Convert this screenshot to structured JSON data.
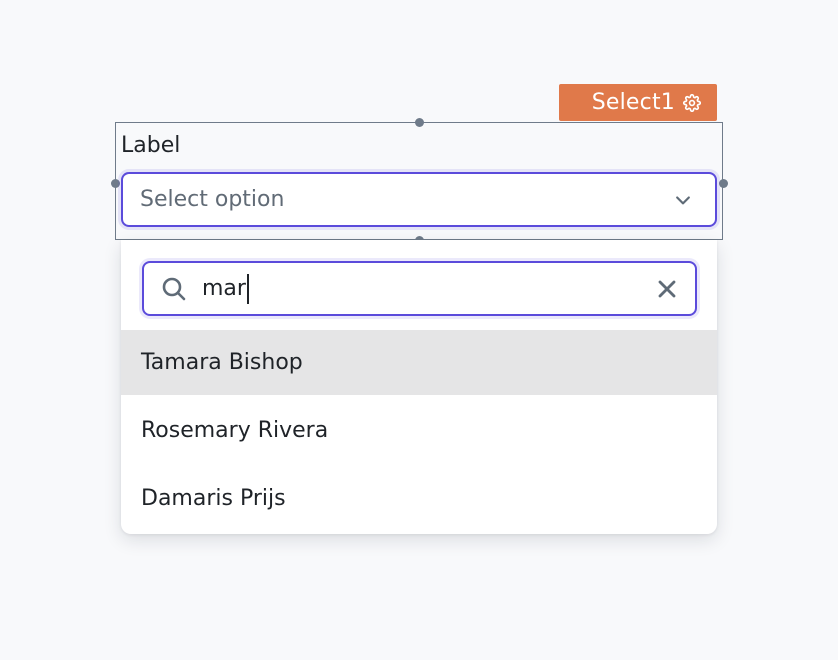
{
  "component_tag": {
    "name": "Select1",
    "icon": "gear-icon",
    "color": "#e0794a"
  },
  "field": {
    "label": "Label",
    "placeholder": "Select option",
    "chevron_icon": "chevron-down-icon",
    "accent_color": "#5b4bdb"
  },
  "search": {
    "value": "mar",
    "icon": "search-icon",
    "clear_icon": "close-icon"
  },
  "options": [
    {
      "label": "Tamara Bishop",
      "highlighted": true
    },
    {
      "label": "Rosemary Rivera",
      "highlighted": false
    },
    {
      "label": "Damaris Prijs",
      "highlighted": false
    }
  ]
}
